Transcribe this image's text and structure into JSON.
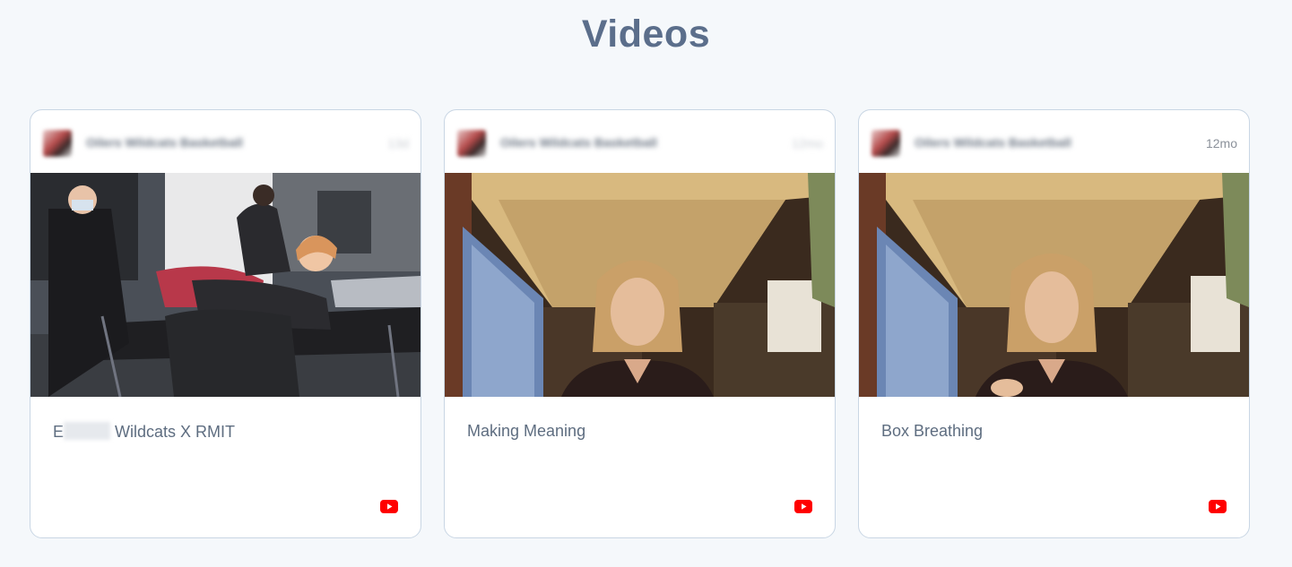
{
  "section": {
    "title": "Videos"
  },
  "cards": [
    {
      "author": "Oilers Wildcats Basketball",
      "age": "13d",
      "title_prefix": "E",
      "title_rest": " Wildcats X RMIT",
      "source_icon": "youtube-icon"
    },
    {
      "author": "Oilers Wildcats Basketball",
      "age": "12mo",
      "title": "Making Meaning",
      "source_icon": "youtube-icon"
    },
    {
      "author": "Oilers Wildcats Basketball",
      "age": "12mo",
      "title": "Box Breathing",
      "source_icon": "youtube-icon"
    }
  ],
  "colors": {
    "background": "#f5f8fb",
    "title": "#5b6e8b",
    "card_border": "#c9d6e4",
    "youtube_red": "#ff0000"
  }
}
